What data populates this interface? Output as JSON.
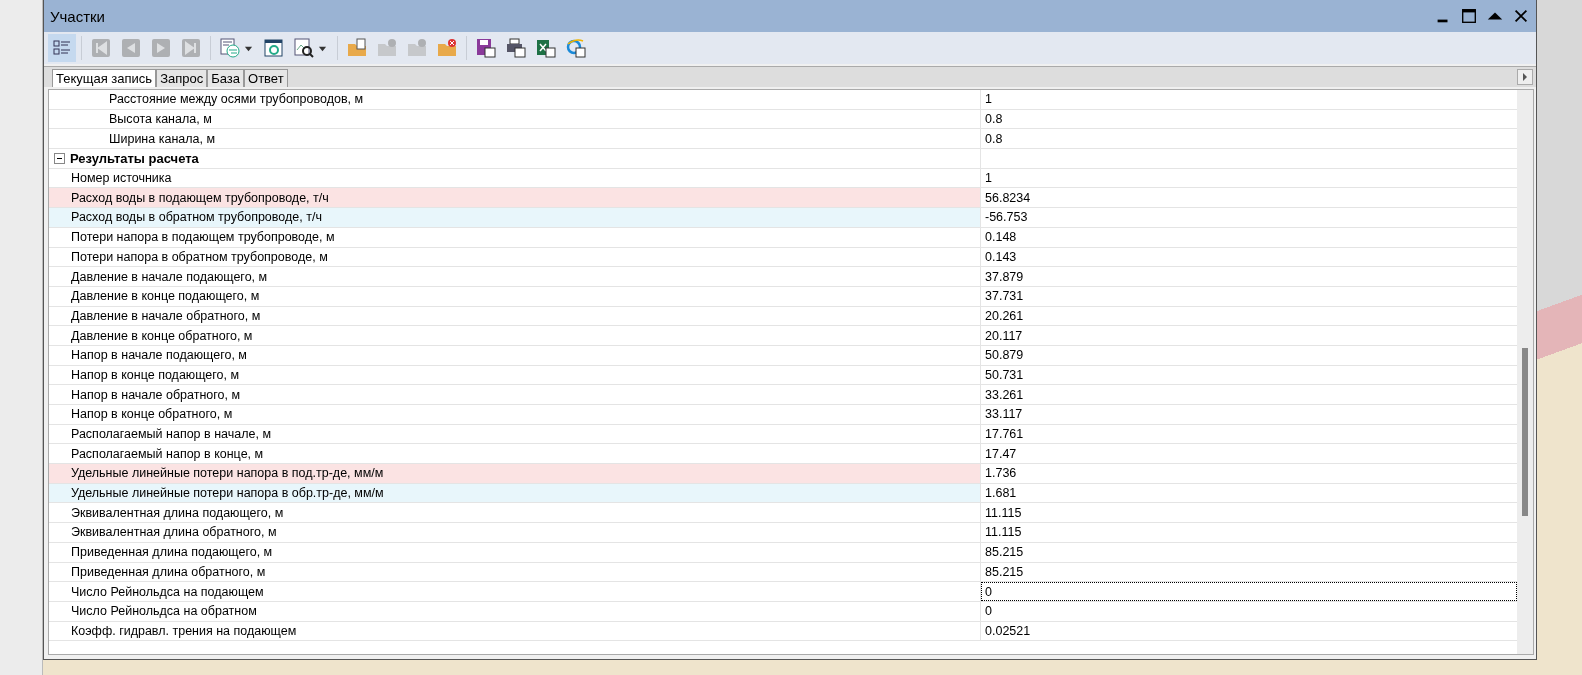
{
  "window": {
    "title": "Участки"
  },
  "toolbar": [
    {
      "kind": "properties",
      "selected": true,
      "disabled": false
    },
    {
      "kind": "first",
      "disabled": true
    },
    {
      "kind": "prev",
      "disabled": true
    },
    {
      "kind": "next",
      "disabled": true
    },
    {
      "kind": "last",
      "disabled": true
    },
    {
      "kind": "exchange",
      "disabled": false,
      "dropdown": true
    },
    {
      "kind": "refresh",
      "disabled": false
    },
    {
      "kind": "find",
      "disabled": false,
      "dropdown": true
    },
    {
      "kind": "new",
      "disabled": false
    },
    {
      "kind": "accept",
      "disabled": true
    },
    {
      "kind": "add",
      "disabled": true
    },
    {
      "kind": "delete",
      "disabled": false
    },
    {
      "kind": "save",
      "disabled": false
    },
    {
      "kind": "print",
      "disabled": false
    },
    {
      "kind": "excel",
      "disabled": false
    },
    {
      "kind": "web",
      "disabled": false
    }
  ],
  "tabs": [
    {
      "label": "Текущая запись",
      "selected": true
    },
    {
      "label": "Запрос",
      "selected": false
    },
    {
      "label": "База",
      "selected": false
    },
    {
      "label": "Ответ",
      "selected": false
    }
  ],
  "property_grid": {
    "items": [
      {
        "kind": "tail",
        "children": [
          {
            "label": "Расстояние между осями трубопроводов, м",
            "value": "1"
          },
          {
            "label": "Высота канала, м",
            "value": "0.8"
          },
          {
            "label": "Ширина канала, м",
            "value": "0.8"
          }
        ]
      },
      {
        "kind": "category",
        "label": "Результаты расчета",
        "expanded": true,
        "children": [
          {
            "label": "Номер источника",
            "value": "1",
            "selected": false
          },
          {
            "label": "Расход воды в подающем трубопроводе, т/ч",
            "value": "56.8234",
            "selected": false,
            "color": "#fbe3e3"
          },
          {
            "label": "Расход воды в обратном трубопроводе, т/ч",
            "value": "-56.753",
            "selected": false,
            "color": "#e8f6fb"
          },
          {
            "label": "Потери напора в подающем трубопроводе, м",
            "value": "0.148",
            "selected": false
          },
          {
            "label": "Потери напора в обратном трубопроводе, м",
            "value": "0.143",
            "selected": false
          },
          {
            "label": "Давление в начале подающего, м",
            "value": "37.879",
            "selected": false
          },
          {
            "label": "Давление в конце подающего, м",
            "value": "37.731",
            "selected": false
          },
          {
            "label": "Давление в начале обратного, м",
            "value": "20.261",
            "selected": false
          },
          {
            "label": "Давление в конце обратного, м",
            "value": "20.117",
            "selected": false
          },
          {
            "label": "Напор в начале подающего, м",
            "value": "50.879",
            "selected": false
          },
          {
            "label": "Напор в конце подающего, м",
            "value": "50.731",
            "selected": false
          },
          {
            "label": "Напор в начале обратного, м",
            "value": "33.261",
            "selected": false
          },
          {
            "label": "Напор в конце обратного, м",
            "value": "33.117",
            "selected": false
          },
          {
            "label": "Располагаемый напор в начале, м",
            "value": "17.761",
            "selected": false
          },
          {
            "label": "Располагаемый напор в конце, м",
            "value": "17.47",
            "selected": false
          },
          {
            "label": "Удельные линейные потери напора в под.тр-де, мм/м",
            "value": "1.736",
            "selected": false,
            "color": "#fbe3e3"
          },
          {
            "label": "Удельные линейные потери напора в обр.тр-де, мм/м",
            "value": "1.681",
            "selected": false,
            "color": "#e8f6fb"
          },
          {
            "label": "Эквивалентная длина подающего, м",
            "value": "11.115",
            "selected": false
          },
          {
            "label": "Эквивалентная длина обратного, м",
            "value": "11.115",
            "selected": false
          },
          {
            "label": "Приведенная длина подающего, м",
            "value": "85.215",
            "selected": false
          },
          {
            "label": "Приведенная длина обратного, м",
            "value": "85.215",
            "selected": false
          },
          {
            "label": "Число Рейнольдса на подающем",
            "value": "0",
            "selected": true
          },
          {
            "label": "Число Рейнольдса на обратном",
            "value": "0",
            "selected": false
          },
          {
            "label": "Коэфф. гидравл. трения на подающем",
            "value": "0.02521",
            "selected": false
          }
        ]
      }
    ]
  }
}
